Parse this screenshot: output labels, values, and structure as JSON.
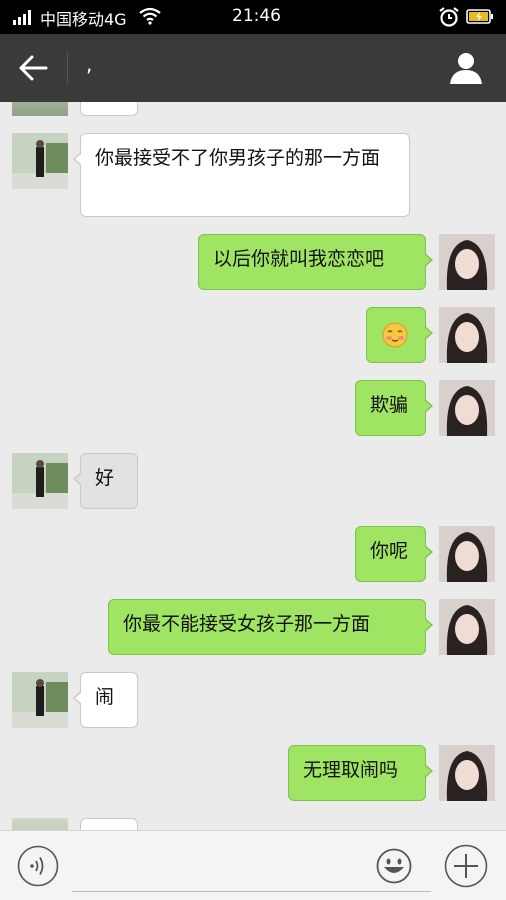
{
  "status_bar": {
    "carrier": "中国移动4G",
    "time": "21:46",
    "icons": [
      "signal-icon",
      "wifi-icon",
      "alarm-icon",
      "battery-charging-icon"
    ]
  },
  "header": {
    "title": ",",
    "icons": [
      "back-arrow-icon",
      "profile-icon"
    ]
  },
  "messages": [
    {
      "from": "other",
      "text": ""
    },
    {
      "from": "other",
      "text": "你最接受不了你男孩子的那一方面"
    },
    {
      "from": "me",
      "text": "以后你就叫我恋恋吧"
    },
    {
      "from": "me",
      "text": "",
      "emoji": "blushing-face-emoji"
    },
    {
      "from": "me",
      "text": "欺骗"
    },
    {
      "from": "other",
      "text": "好"
    },
    {
      "from": "me",
      "text": "你呢"
    },
    {
      "from": "me",
      "text": "你最不能接受女孩子那一方面"
    },
    {
      "from": "other",
      "text": "闹"
    },
    {
      "from": "me",
      "text": "无理取闹吗"
    },
    {
      "from": "other",
      "text": ""
    }
  ],
  "input_bar": {
    "value": "",
    "placeholder": "",
    "icons": [
      "voice-icon",
      "emoji-icon",
      "plus-icon"
    ]
  },
  "colors": {
    "outgoing_bubble": "#9fe563",
    "incoming_bubble": "#ffffff",
    "header": "#3a3a3a",
    "background": "#ebebeb"
  }
}
